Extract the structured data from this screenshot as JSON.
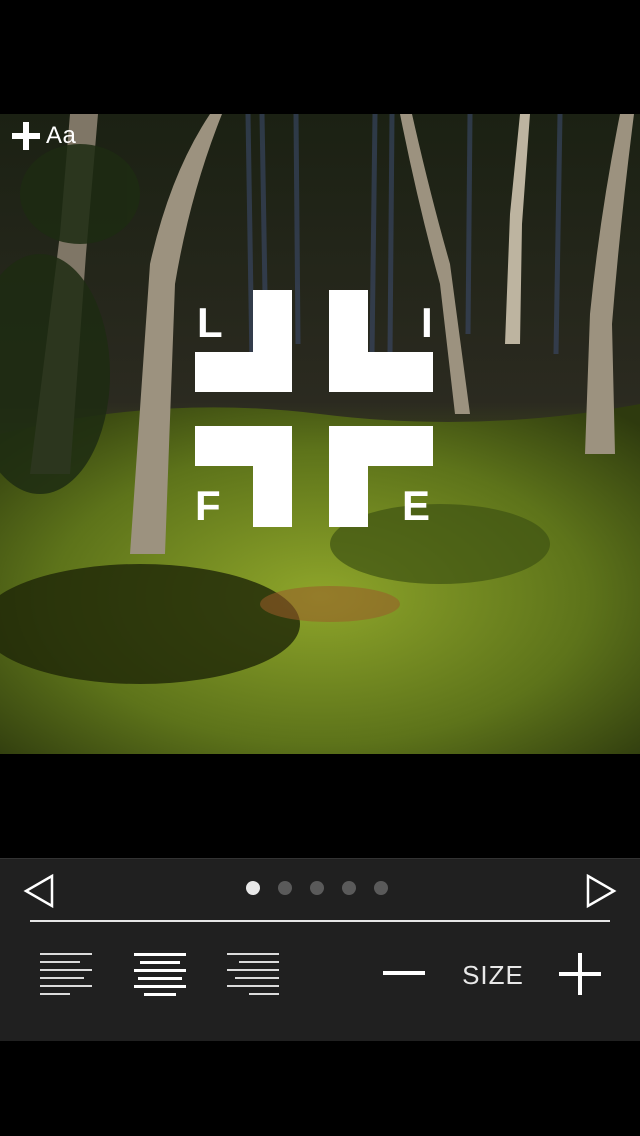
{
  "editor": {
    "add_text_label": "Aa"
  },
  "logo": {
    "letters": [
      "L",
      "I",
      "F",
      "E"
    ]
  },
  "toolbar": {
    "pages": 5,
    "active_page": 1,
    "alignment_selected": "center",
    "size_label": "SIZE"
  },
  "colors": {
    "toolbar_bg": "#202020",
    "accent": "#ffffff"
  }
}
